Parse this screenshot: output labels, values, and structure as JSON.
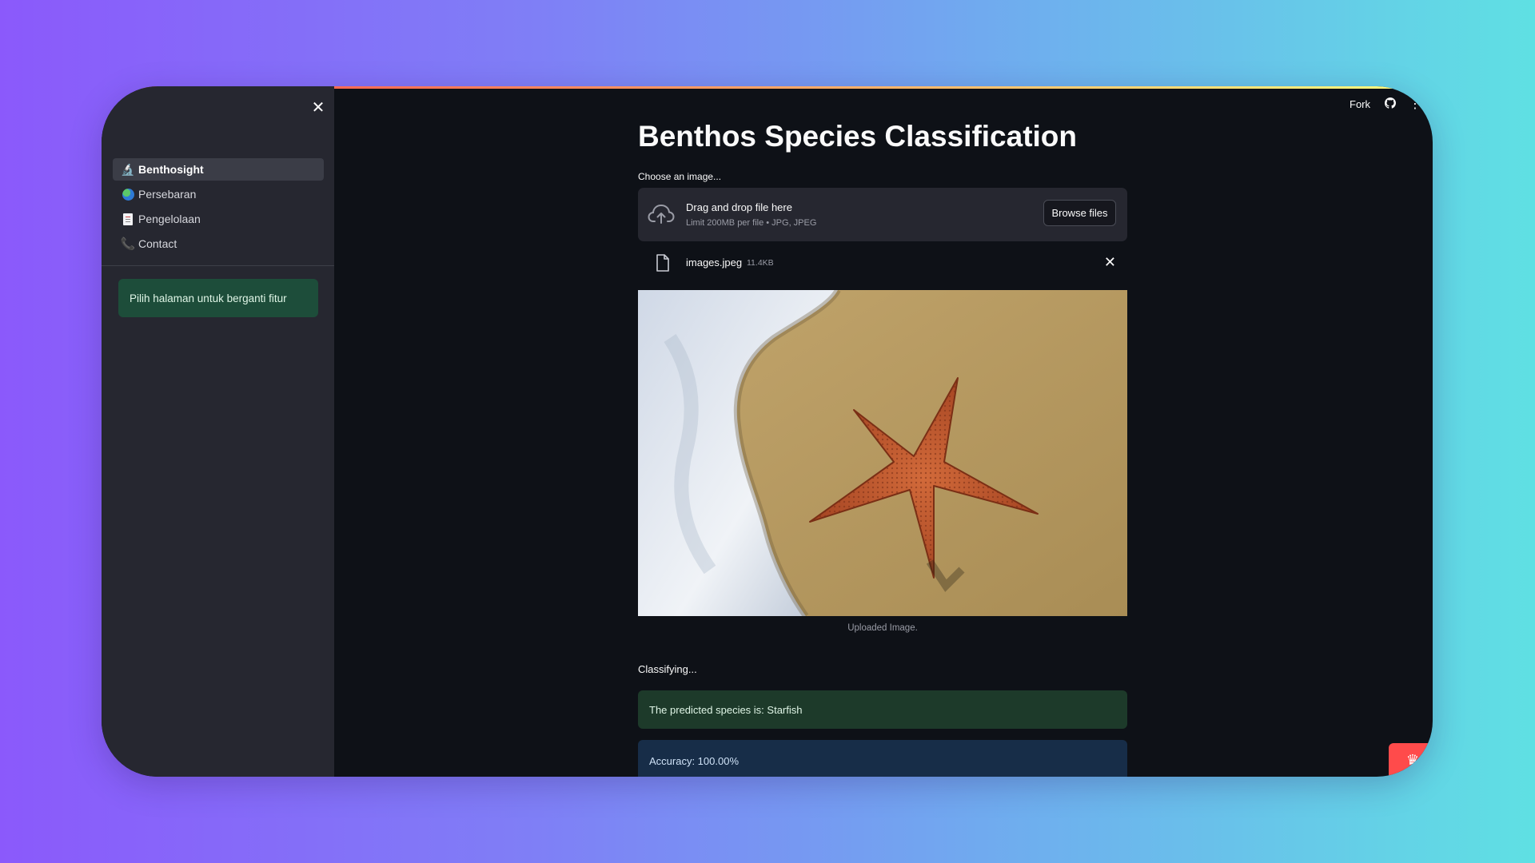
{
  "sidebar": {
    "items": [
      {
        "label": "Benthosight",
        "icon": "microscope-icon",
        "active": true
      },
      {
        "label": "Persebaran",
        "icon": "globe-icon",
        "active": false
      },
      {
        "label": "Pengelolaan",
        "icon": "document-icon",
        "active": false
      },
      {
        "label": "Contact",
        "icon": "phone-icon",
        "active": false
      }
    ],
    "info_message": "Pilih halaman untuk berganti fitur"
  },
  "header": {
    "fork_label": "Fork"
  },
  "main": {
    "title": "Benthos Species Classification",
    "uploader_label": "Choose an image...",
    "dropzone": {
      "title": "Drag and drop file here",
      "subtitle": "Limit 200MB per file • JPG, JPEG",
      "browse_label": "Browse files"
    },
    "file": {
      "name": "images.jpeg",
      "size": "11.4KB"
    },
    "image_caption": "Uploaded Image.",
    "status_text": "Classifying...",
    "prediction": "The predicted species is: Starfish",
    "accuracy": "Accuracy: 100.00%"
  },
  "colors": {
    "app_background": "#0e1117",
    "sidebar_background": "#262730",
    "accent": "#ff4b4b",
    "success_background": "#1d3a2a",
    "info_background": "#172d48"
  }
}
